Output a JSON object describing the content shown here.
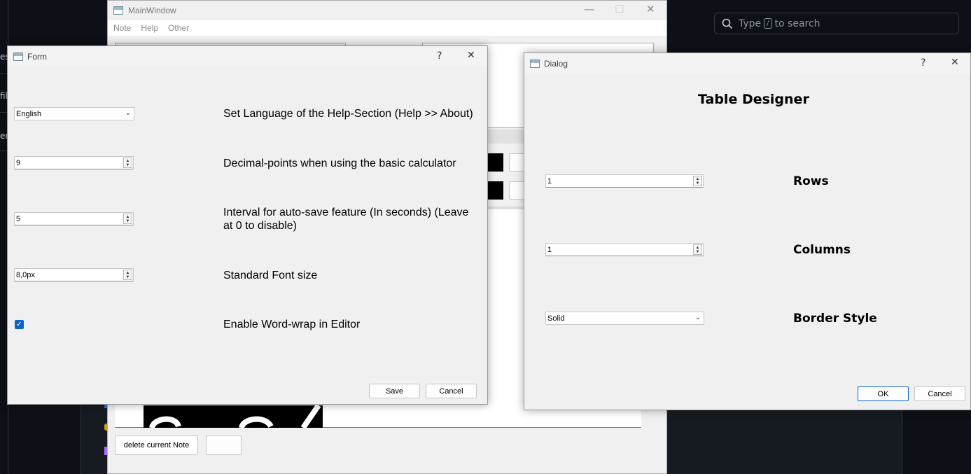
{
  "background_app": {
    "search_placeholder_pre": "Type",
    "search_key": "/",
    "search_placeholder_post": "to search",
    "left_fragments": [
      "es",
      "fil",
      "er"
    ]
  },
  "main_window": {
    "title": "MainWindow",
    "menu": [
      "Note",
      "Help",
      "Other"
    ],
    "delete_button": "delete current Note",
    "controls": {
      "minimize": "—",
      "maximize": "☐",
      "close": "✕"
    }
  },
  "form_dialog": {
    "title": "Form",
    "help": "?",
    "close": "✕",
    "language_value": "English",
    "language_label": "Set Language of the Help-Section (Help >> About)",
    "decimal_value": "9",
    "decimal_label": "Decimal-points when using the basic calculator",
    "autosave_value": "5",
    "autosave_label": "Interval for auto-save feature (In seconds) (Leave at 0 to disable)",
    "fontsize_value": "8,0px",
    "fontsize_label": "Standard Font size",
    "wordwrap_checked": true,
    "wordwrap_label": "Enable Word-wrap in Editor",
    "save": "Save",
    "cancel": "Cancel"
  },
  "table_dialog": {
    "title": "Dialog",
    "help": "?",
    "close": "✕",
    "heading": "Table Designer",
    "rows_value": "1",
    "rows_label": "Rows",
    "columns_value": "1",
    "columns_label": "Columns",
    "border_value": "Solid",
    "border_label": "Border Style",
    "ok": "OK",
    "cancel": "Cancel"
  },
  "colors": {
    "accent": "#0a63c9",
    "dialog_bg": "#f0f0f0",
    "dark_bg": "#0d1117"
  }
}
